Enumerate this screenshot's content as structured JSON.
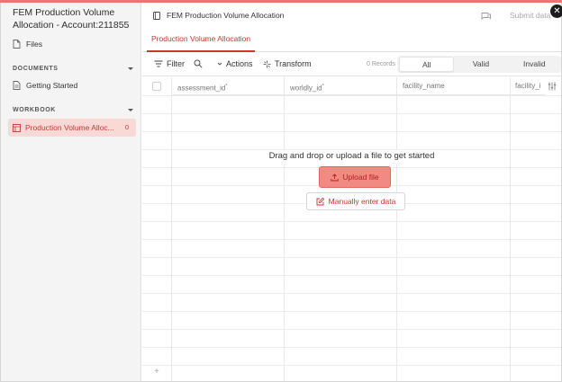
{
  "app": {
    "title": "FEM Production Volume Allocation - Account:211855",
    "files_label": "Files"
  },
  "sidebar": {
    "documents_header": "DOCUMENTS",
    "documents": [
      {
        "label": "Getting Started"
      }
    ],
    "workbook_header": "WORKBOOK",
    "sheets": [
      {
        "label": "Production Volume Alloc...",
        "count": "0"
      }
    ]
  },
  "header": {
    "document_title": "FEM Production Volume Allocation",
    "submit_label": "Submit data",
    "close_glyph": "✕"
  },
  "tabs": [
    {
      "label": "Production Volume Allocation",
      "active": true
    }
  ],
  "toolbar": {
    "filter_label": "Filter",
    "actions_label": "Actions",
    "transform_label": "Transform",
    "records_label": "0 Records",
    "segments": [
      "All",
      "Valid",
      "Invalid"
    ],
    "active_segment": "All"
  },
  "grid": {
    "columns": [
      {
        "name": "assessment_id",
        "required": true
      },
      {
        "name": "worldly_id",
        "required": true
      },
      {
        "name": "facility_name",
        "required": false
      },
      {
        "name": "facility_i",
        "required": false
      }
    ],
    "add_row_glyph": "+"
  },
  "empty_state": {
    "message": "Drag and drop or upload a file to get started",
    "upload_label": "Upload file",
    "manual_label": "Manually enter data"
  },
  "colors": {
    "accent": "#c43a33",
    "accent_light": "#f8d9d6",
    "upload_bg": "#f08a83"
  }
}
